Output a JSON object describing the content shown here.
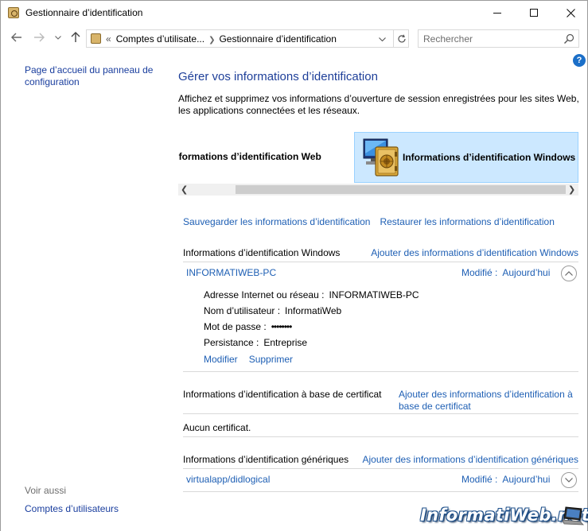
{
  "window": {
    "title": "Gestionnaire d’identification",
    "icon": "credential-vault-icon"
  },
  "nav": {
    "breadcrumb_root_glyph": "«",
    "breadcrumb": [
      "Comptes d’utilisate...",
      "Gestionnaire d’identification"
    ],
    "search_placeholder": "Rechercher"
  },
  "sidebar": {
    "home_link": "Page d’accueil du panneau de configuration",
    "see_also_label": "Voir aussi",
    "see_also_items": [
      "Comptes d’utilisateurs"
    ]
  },
  "main": {
    "title": "Gérer vos informations d’identification",
    "description": "Affichez et supprimez vos informations d’ouverture de session enregistrées pour les sites Web, les applications connectées et les réseaux.",
    "tabs": [
      {
        "label": "Informations d’identification Web",
        "selected": false
      },
      {
        "label": "Informations d’identification Windows",
        "selected": true
      }
    ],
    "backup_link": "Sauvegarder les informations d’identification",
    "restore_link": "Restaurer les informations d’identification",
    "windows_section": {
      "title": "Informations d’identification Windows",
      "add_link": "Ajouter des informations d’identification Windows",
      "entries": [
        {
          "name": "INFORMATIWEB-PC",
          "modified_label": "Modifié :",
          "modified_value": "Aujourd’hui",
          "expanded": true,
          "details": [
            {
              "key": "Adresse Internet ou réseau :",
              "value": "INFORMATIWEB-PC"
            },
            {
              "key": "Nom d’utilisateur :",
              "value": "InformatiWeb"
            },
            {
              "key": "Mot de passe :",
              "value": "••••••••"
            },
            {
              "key": "Persistance :",
              "value": "Entreprise"
            }
          ],
          "edit_label": "Modifier",
          "delete_label": "Supprimer"
        }
      ]
    },
    "certificate_section": {
      "title": "Informations d’identification à base de certificat",
      "add_link": "Ajouter des informations d’identification à base de certificat",
      "empty_text": "Aucun certificat."
    },
    "generic_section": {
      "title": "Informations d’identification génériques",
      "add_link": "Ajouter des informations d’identification génériques",
      "entries": [
        {
          "name": "virtualapp/didlogical",
          "modified_label": "Modifié :",
          "modified_value": "Aujourd’hui",
          "expanded": false
        }
      ]
    }
  },
  "watermark": {
    "text": "InformatiWeb.net"
  },
  "colors": {
    "link": "#1e5fb4",
    "title": "#1e3f99",
    "selected_tab_bg": "#cce8ff",
    "help": "#1b6fc8"
  }
}
